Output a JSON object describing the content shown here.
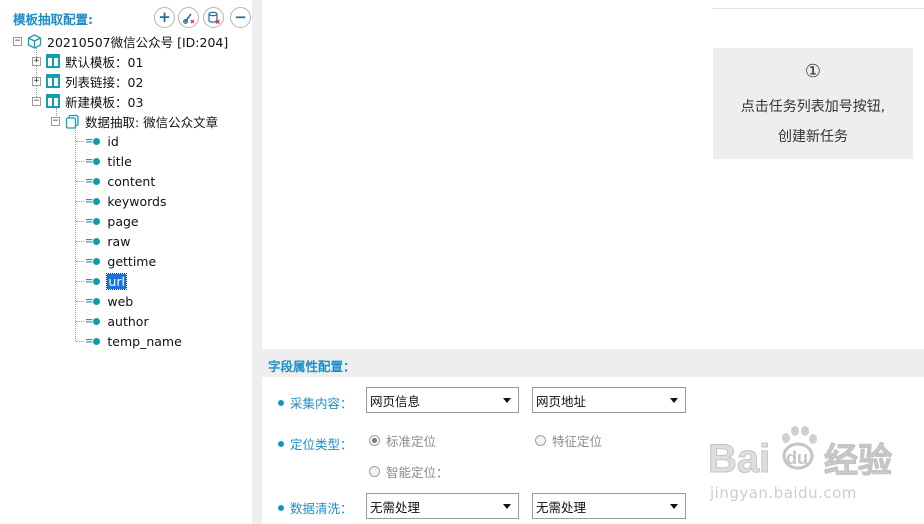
{
  "left_panel": {
    "title": "模板抽取配置:",
    "toolbar": {
      "add_icon": "plus-icon",
      "edit_icon": "edit-link-icon",
      "db_icon": "database-icon",
      "remove_icon": "minus-icon",
      "add": "+",
      "remove": "−"
    },
    "tree": {
      "root": {
        "label": "20210507微信公众号 [ID:204]",
        "icon": "cube-icon"
      },
      "templates": [
        {
          "label": "默认模板：01",
          "expander": "+"
        },
        {
          "label": "列表链接：02",
          "expander": "+"
        },
        {
          "label": "新建模板：03",
          "expander": "−"
        }
      ],
      "extract": {
        "label": "数据抽取: 微信公众文章",
        "icon": "copy-icon",
        "expander": "−"
      },
      "fields": [
        "id",
        "title",
        "content",
        "keywords",
        "page",
        "raw",
        "gettime",
        "url",
        "web",
        "author",
        "temp_name"
      ],
      "selected_field": "url",
      "field_marker": "=",
      "collapse_glyph": "−"
    }
  },
  "hint": {
    "number": "①",
    "line1": "点击任务列表加号按钮,",
    "line2": "创建新任务"
  },
  "field_config": {
    "header": "字段属性配置：",
    "collect_label": "采集内容：",
    "collect_value1": "网页信息",
    "collect_value2": "网页地址",
    "locate_label": "定位类型：",
    "radio_standard": "标准定位",
    "radio_feature": "特征定位",
    "radio_smart": "智能定位：",
    "clean_label": "数据清洗：",
    "clean_value1": "无需处理",
    "clean_value2": "无需处理"
  },
  "watermark": {
    "brand": "Bai du 经验",
    "url": "jingyan.baidu.com"
  },
  "colors": {
    "accent": "#1d8fc8",
    "teal": "#149eb0",
    "selection": "#1a73d9",
    "panel_bg": "#eeeeee"
  }
}
